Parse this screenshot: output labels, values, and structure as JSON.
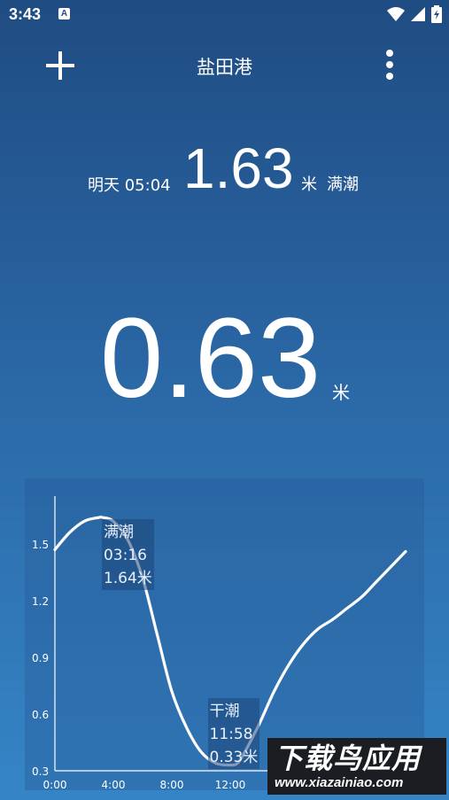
{
  "status_bar": {
    "time": "3:43",
    "notification_badge": "A",
    "icons": [
      "wifi-icon",
      "signal-icon",
      "battery-icon"
    ]
  },
  "header": {
    "title": "盐田港",
    "add_icon": "plus-icon",
    "menu_icon": "more-vert-icon"
  },
  "next_tide": {
    "time": "明天 05:04",
    "height": "1.63",
    "unit": "米",
    "type": "满潮"
  },
  "current": {
    "height": "0.63",
    "unit": "米"
  },
  "chart_data": {
    "type": "line",
    "x_tick_labels": [
      "0:00",
      "4:00",
      "8:00",
      "12:00"
    ],
    "y_tick_labels": [
      "1.5",
      "1.2",
      "0.9",
      "0.6",
      "0.3"
    ],
    "y_ticks": [
      1.5,
      1.2,
      0.9,
      0.6,
      0.3
    ],
    "x_ticks": [
      0,
      4,
      8,
      12
    ],
    "xlim": [
      0,
      24
    ],
    "ylim": [
      0.2,
      1.75
    ],
    "series": [
      {
        "x": [
          0,
          1,
          2,
          3,
          3.27,
          4,
          5,
          6,
          7,
          8,
          9,
          10,
          11,
          11.97,
          12.5,
          13,
          14,
          15,
          16,
          17,
          18,
          19,
          20,
          21,
          22,
          23,
          24
        ],
        "values": [
          1.47,
          1.56,
          1.62,
          1.64,
          1.64,
          1.62,
          1.52,
          1.32,
          1.02,
          0.72,
          0.53,
          0.4,
          0.34,
          0.33,
          0.34,
          0.4,
          0.55,
          0.72,
          0.86,
          0.97,
          1.05,
          1.1,
          1.16,
          1.22,
          1.3,
          1.38,
          1.46
        ]
      }
    ],
    "annotations": [
      {
        "label": "满潮",
        "time": "03:16",
        "value": "1.64米"
      },
      {
        "label": "干潮",
        "time": "11:58",
        "value": "0.33米"
      }
    ],
    "grid": false
  },
  "watermark": {
    "title": "下载鸟应用",
    "url": "www.xiazainiao.com"
  }
}
